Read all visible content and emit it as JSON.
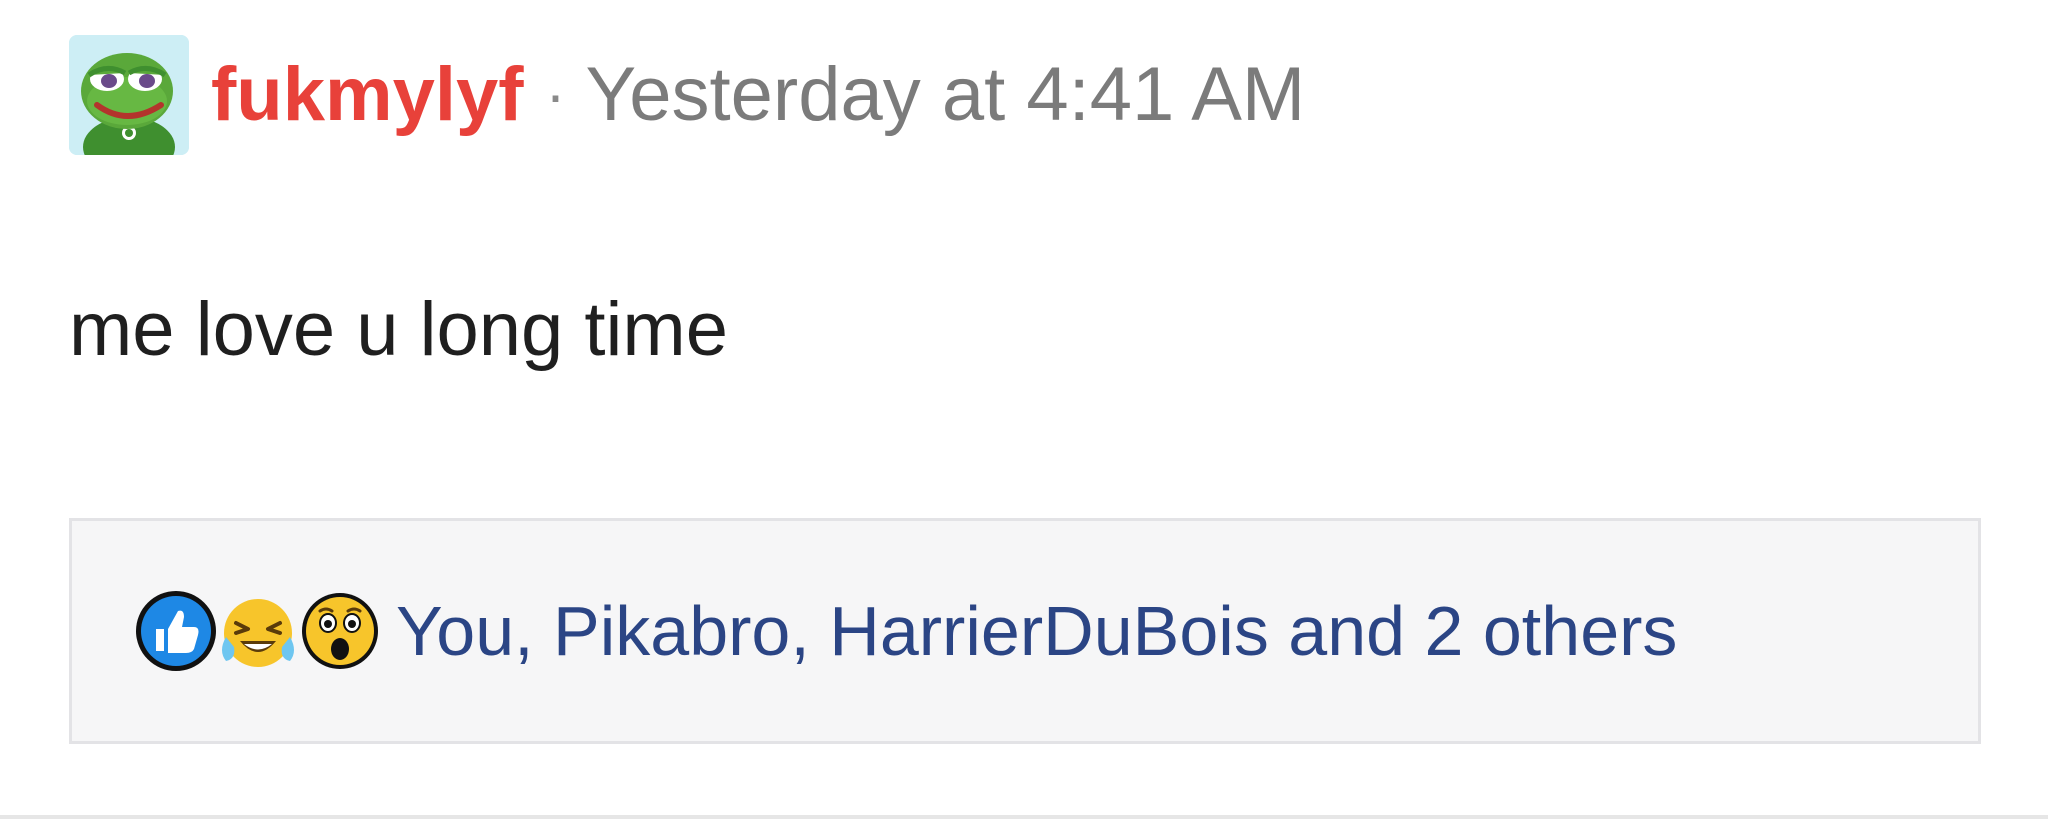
{
  "post": {
    "username": "fukmylyf",
    "separator": "·",
    "timestamp": "Yesterday at 4:41 AM",
    "message": "me love u long time",
    "avatar_icon": "frog-avatar-icon"
  },
  "reactions": {
    "icons": [
      "like-icon",
      "laughing-crying-icon",
      "surprised-icon"
    ],
    "users_text": "You, Pikabro, HarrierDuBois and 2 others"
  },
  "colors": {
    "username": "#e8413a",
    "timestamp": "#7b7b7b",
    "reaction_link": "#2b4585",
    "reaction_bar_bg": "#f6f6f7"
  }
}
